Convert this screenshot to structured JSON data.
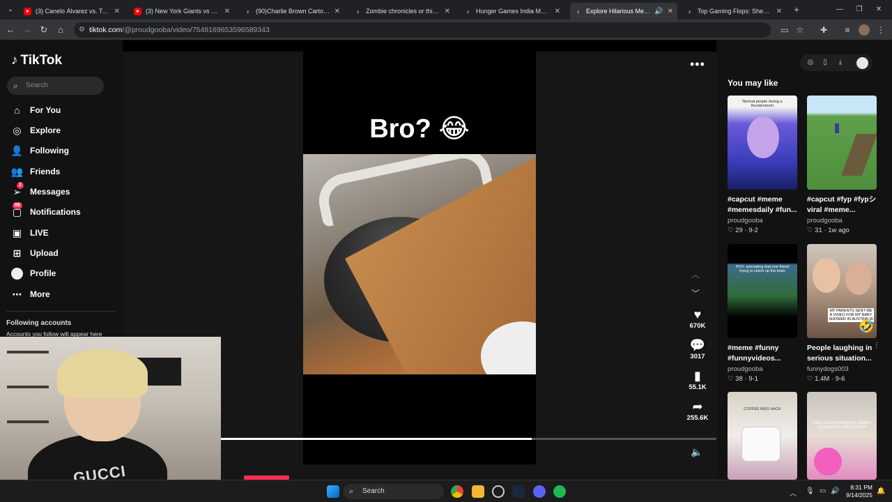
{
  "browser": {
    "tabs": [
      {
        "label": "(3) Canelo Álvarez vs. Terence C",
        "favicon": "youtube",
        "active": false
      },
      {
        "label": "(3) New York Giants vs Dallas C",
        "favicon": "youtube",
        "active": false
      },
      {
        "label": "(90)Charlie Brown Cartoon Edit",
        "favicon": "tiktok",
        "active": false
      },
      {
        "label": "Zombie chronicles or this #zom",
        "favicon": "tiktok",
        "active": false
      },
      {
        "label": "Hunger Games India Meme: Fu",
        "favicon": "tiktok",
        "active": false
      },
      {
        "label": "Explore Hilarious Memes ar",
        "favicon": "tiktok",
        "active": true
      },
      {
        "label": "Top Gaming Flops: Shenmue, S",
        "favicon": "tiktok",
        "active": false
      }
    ],
    "url_host": "tiktok.com",
    "url_path": "/@proudgooba/video/7548169653596589343"
  },
  "sidebar": {
    "logo": "TikTok",
    "search_placeholder": "Search",
    "items": [
      {
        "label": "For You",
        "icon": "home-icon"
      },
      {
        "label": "Explore",
        "icon": "compass-icon"
      },
      {
        "label": "Following",
        "icon": "user-icon"
      },
      {
        "label": "Friends",
        "icon": "users-icon"
      },
      {
        "label": "Messages",
        "icon": "send-icon",
        "badge": "2"
      },
      {
        "label": "Notifications",
        "icon": "inbox-icon",
        "badge": "88"
      },
      {
        "label": "LIVE",
        "icon": "live-icon"
      },
      {
        "label": "Upload",
        "icon": "plus-square-icon"
      },
      {
        "label": "Profile",
        "icon": "avatar-icon"
      },
      {
        "label": "More",
        "icon": "more-icon"
      }
    ],
    "following_heading": "Following accounts",
    "following_sub": "Accounts you follow will appear here"
  },
  "video": {
    "caption": "Bro? 😂",
    "likes": "670K",
    "comments": "3017",
    "saves": "55.1K",
    "shares": "255.6K",
    "progress": 0.627
  },
  "right_panel": {
    "title": "You may like",
    "cards": [
      {
        "title": "#capcut #meme #memesdaily #fun...",
        "user": "proudgooba",
        "likes": "29",
        "date": "9-2",
        "thumb_text": "Normal people during a thunderstorm"
      },
      {
        "title": "#capcut #fyp #fypシ viral #meme...",
        "user": "proudgooba",
        "likes": "31",
        "date": "1w ago",
        "thumb_text": ""
      },
      {
        "title": "#meme #funny #funnyvideos...",
        "user": "proudgooba",
        "likes": "38",
        "date": "9-1",
        "thumb_text": "POV: spectating that one friend trying to clutch up the team"
      },
      {
        "title": "People laughing in serious situation...",
        "user": "funnydogs003",
        "likes": "1.4M",
        "date": "9-6",
        "thumb_text": "MY PARENTS SENT ME A VIDEO FOR MY BABY SHOWER IN AUSTRALIA"
      },
      {
        "title": "",
        "user": "",
        "likes": "",
        "date": "",
        "thumb_text": "COFFEE MUG HACK"
      },
      {
        "title": "",
        "user": "",
        "likes": "",
        "date": "",
        "thumb_text": "How I sound texting my parents to check me out of school"
      }
    ]
  },
  "taskbar": {
    "search": "Search",
    "time": "8:31 PM",
    "date": "9/14/2025"
  },
  "webcam": {
    "shirt_text": "GUCCI"
  }
}
